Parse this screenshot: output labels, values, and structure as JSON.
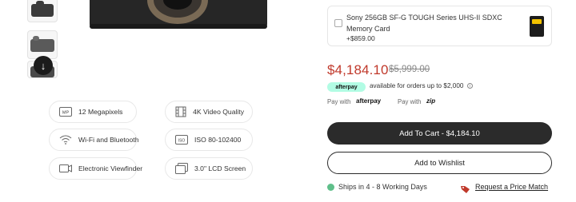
{
  "gallery": {
    "scroll_icon": "arrow-down-icon"
  },
  "features": [
    {
      "icon": "megapixel-icon",
      "badge": "MP",
      "label": "12 Megapixels"
    },
    {
      "icon": "film-icon",
      "label": "4K Video Quality"
    },
    {
      "icon": "wifi-icon",
      "label": "Wi-Fi and Bluetooth"
    },
    {
      "icon": "iso-icon",
      "badge": "ISO",
      "label": "ISO 80-102400"
    },
    {
      "icon": "viewfinder-icon",
      "label": "Electronic Viewfinder"
    },
    {
      "icon": "screen-icon",
      "label": "3.0\" LCD Screen"
    }
  ],
  "upsell": {
    "name": "Sony 256GB SF-G TOUGH Series UHS-II SDXC Memory Card",
    "price": "+$859.00"
  },
  "pricing": {
    "current": "$4,184.10",
    "original": "$5,999.00",
    "current_color": "#c0392b"
  },
  "afterpay": {
    "badge": "afterpay",
    "note": "available for orders up to $2,000",
    "info_symbol": "i"
  },
  "paywith": {
    "label1": "Pay with",
    "logo1": "afterpay",
    "label2": "Pay with",
    "logo2": "zip"
  },
  "actions": {
    "add_to_cart": "Add To Cart - $4,184.10",
    "add_to_wishlist": "Add to Wishlist"
  },
  "shipping": {
    "text": "Ships in 4 - 8 Working Days",
    "status_color": "#5fbf8a"
  },
  "price_match": {
    "text": "Request a Price Match"
  }
}
